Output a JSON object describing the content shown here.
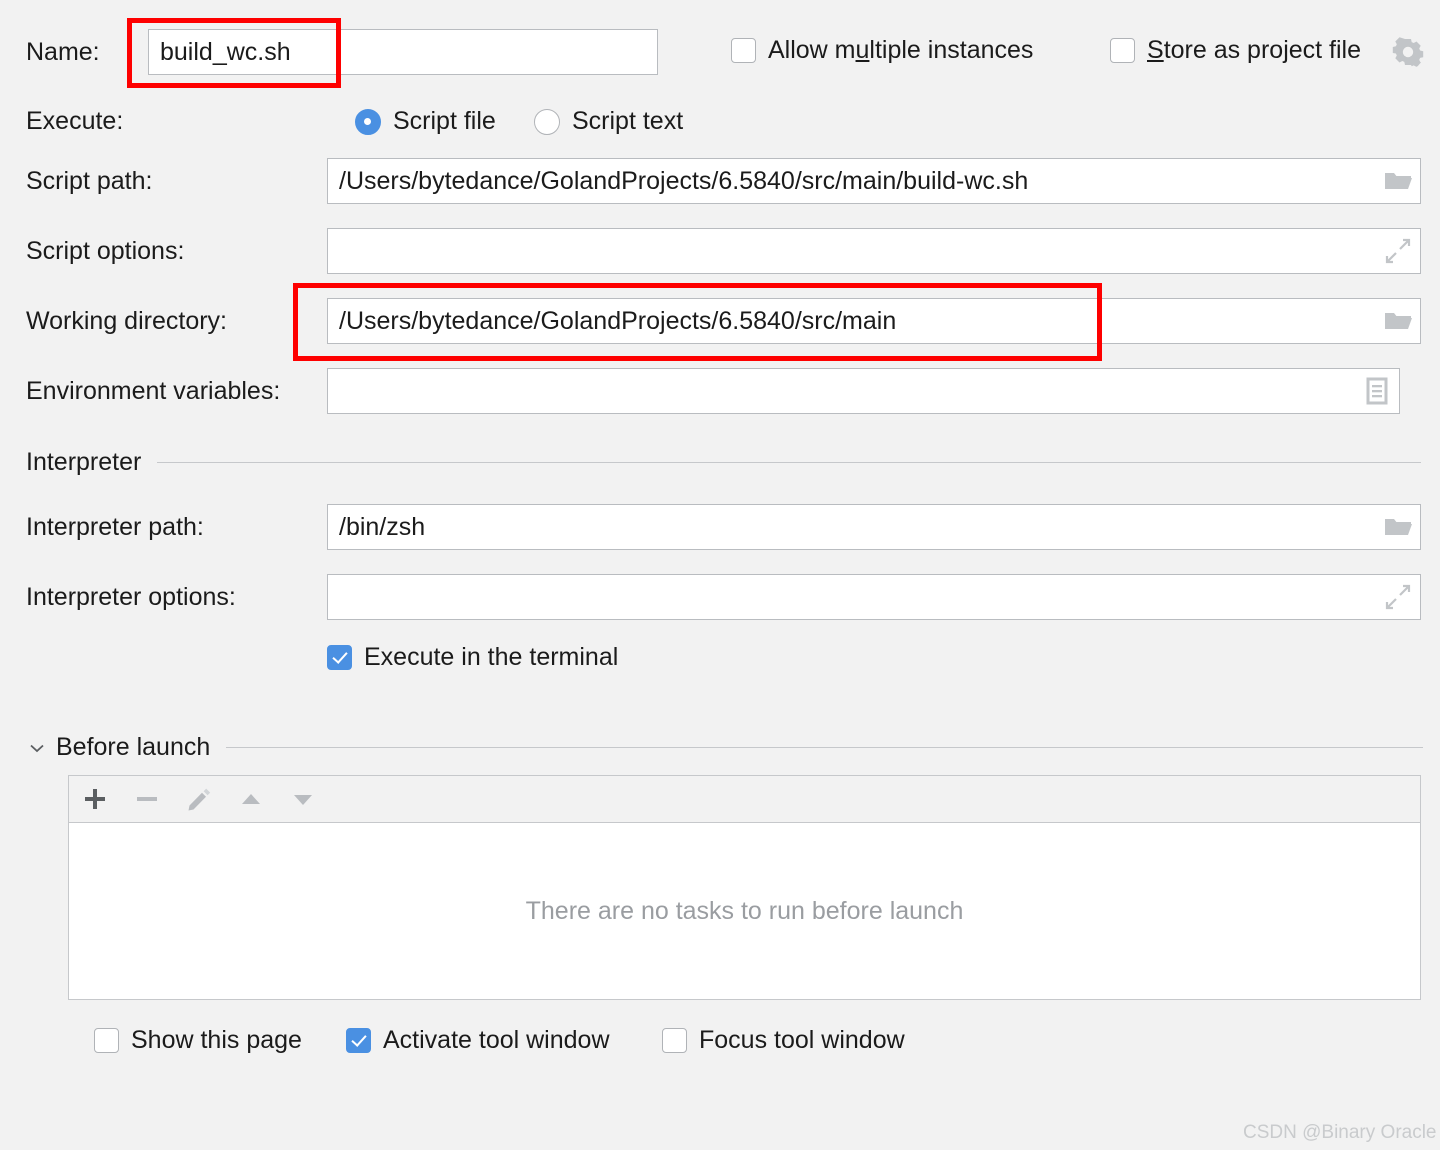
{
  "form": {
    "name_label": "Name:",
    "name_value": "build_wc.sh",
    "execute_label": "Execute:",
    "script_path_label": "Script path:",
    "script_path_value": "/Users/bytedance/GolandProjects/6.5840/src/main/build-wc.sh",
    "script_options_label": "Script options:",
    "script_options_value": "",
    "working_directory_label": "Working directory:",
    "working_directory_value": "/Users/bytedance/GolandProjects/6.5840/src/main",
    "environment_variables_label": "Environment variables:",
    "environment_variables_value": ""
  },
  "top_options": {
    "allow_multiple_instances": {
      "label_before": "Allow m",
      "label_mnemonic": "u",
      "label_after": "ltiple instances",
      "checked": false
    },
    "store_as_project_file": {
      "label_mnemonic": "S",
      "label_after": "tore as project file",
      "checked": false
    },
    "gear_icon": "gear-icon"
  },
  "execute_mode": {
    "options": [
      {
        "label": "Script file",
        "selected": true
      },
      {
        "label": "Script text",
        "selected": false
      }
    ]
  },
  "interpreter": {
    "section_title": "Interpreter",
    "path_label": "Interpreter path:",
    "path_value": "/bin/zsh",
    "options_label": "Interpreter options:",
    "options_value": "",
    "execute_in_terminal": {
      "label": "Execute in the terminal",
      "checked": true
    }
  },
  "before_launch": {
    "section_title": "Before launch",
    "toolbar": [
      {
        "name": "add-button",
        "icon": "plus-icon",
        "enabled": true
      },
      {
        "name": "remove-button",
        "icon": "minus-icon",
        "enabled": false
      },
      {
        "name": "edit-button",
        "icon": "pencil-icon",
        "enabled": false
      },
      {
        "name": "move-up-button",
        "icon": "arrow-up-icon",
        "enabled": false
      },
      {
        "name": "move-down-button",
        "icon": "arrow-down-icon",
        "enabled": false
      }
    ],
    "empty_message": "There are no tasks to run before launch",
    "checkboxes": [
      {
        "label": "Show this page",
        "checked": false
      },
      {
        "label": "Activate tool window",
        "checked": true
      },
      {
        "label": "Focus tool window",
        "checked": false
      }
    ]
  },
  "icons": {
    "folder": "folder-icon",
    "expand": "expand-icon",
    "env_list": "document-list-icon",
    "chevron_down": "chevron-down-icon"
  },
  "annotations": [
    {
      "name": "name-field-highlight",
      "color": "#fe0000"
    },
    {
      "name": "working-directory-highlight",
      "color": "#fe0000"
    }
  ],
  "watermark": "CSDN @Binary Oracle"
}
